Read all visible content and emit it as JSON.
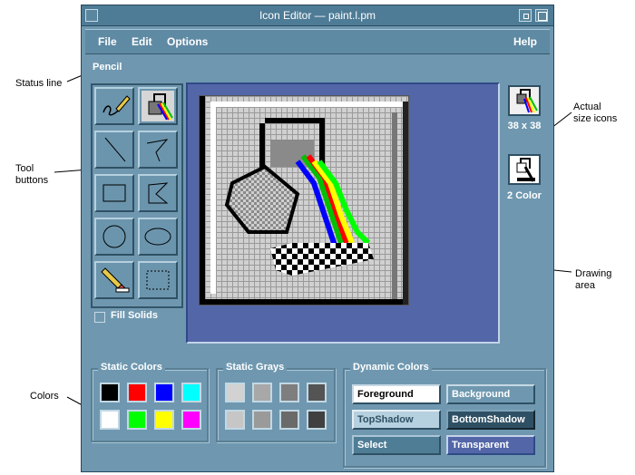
{
  "window": {
    "title": "Icon Editor — paint.l.pm"
  },
  "menu": {
    "file": "File",
    "edit": "Edit",
    "options": "Options",
    "help": "Help"
  },
  "status_line": "Pencil",
  "fill_solids": "Fill Solids",
  "actual_size": {
    "color_label": "38 x 38",
    "mono_label": "2 Color"
  },
  "callouts": {
    "status_line": "Status line",
    "tool_buttons_1": "Tool",
    "tool_buttons_2": "buttons",
    "colors": "Colors",
    "actual_size_1": "Actual",
    "actual_size_2": "size icons",
    "drawing_area_1": "Drawing",
    "drawing_area_2": "area"
  },
  "static_colors": {
    "label": "Static Colors",
    "swatches": [
      "#000000",
      "#ff0000",
      "#0000ff",
      "#00ffff",
      "#ffffff",
      "#00ff00",
      "#ffff00",
      "#ff00ff"
    ]
  },
  "static_grays": {
    "label": "Static Grays",
    "swatches": [
      "#d2d2d2",
      "#a8a8a8",
      "#7e7e7e",
      "#545454",
      "#c6c6c6",
      "#9a9a9a",
      "#6a6a6a",
      "#404040"
    ]
  },
  "dynamic_colors": {
    "label": "Dynamic Colors",
    "foreground": "Foreground",
    "background": "Background",
    "topshadow": "TopShadow",
    "bottomshadow": "BottomShadow",
    "select": "Select",
    "transparent": "Transparent"
  },
  "colors": {
    "window_bg": "#6f98b0",
    "drawing_bg": "#5266a8",
    "canvas_bg": "#cfcfcf"
  }
}
